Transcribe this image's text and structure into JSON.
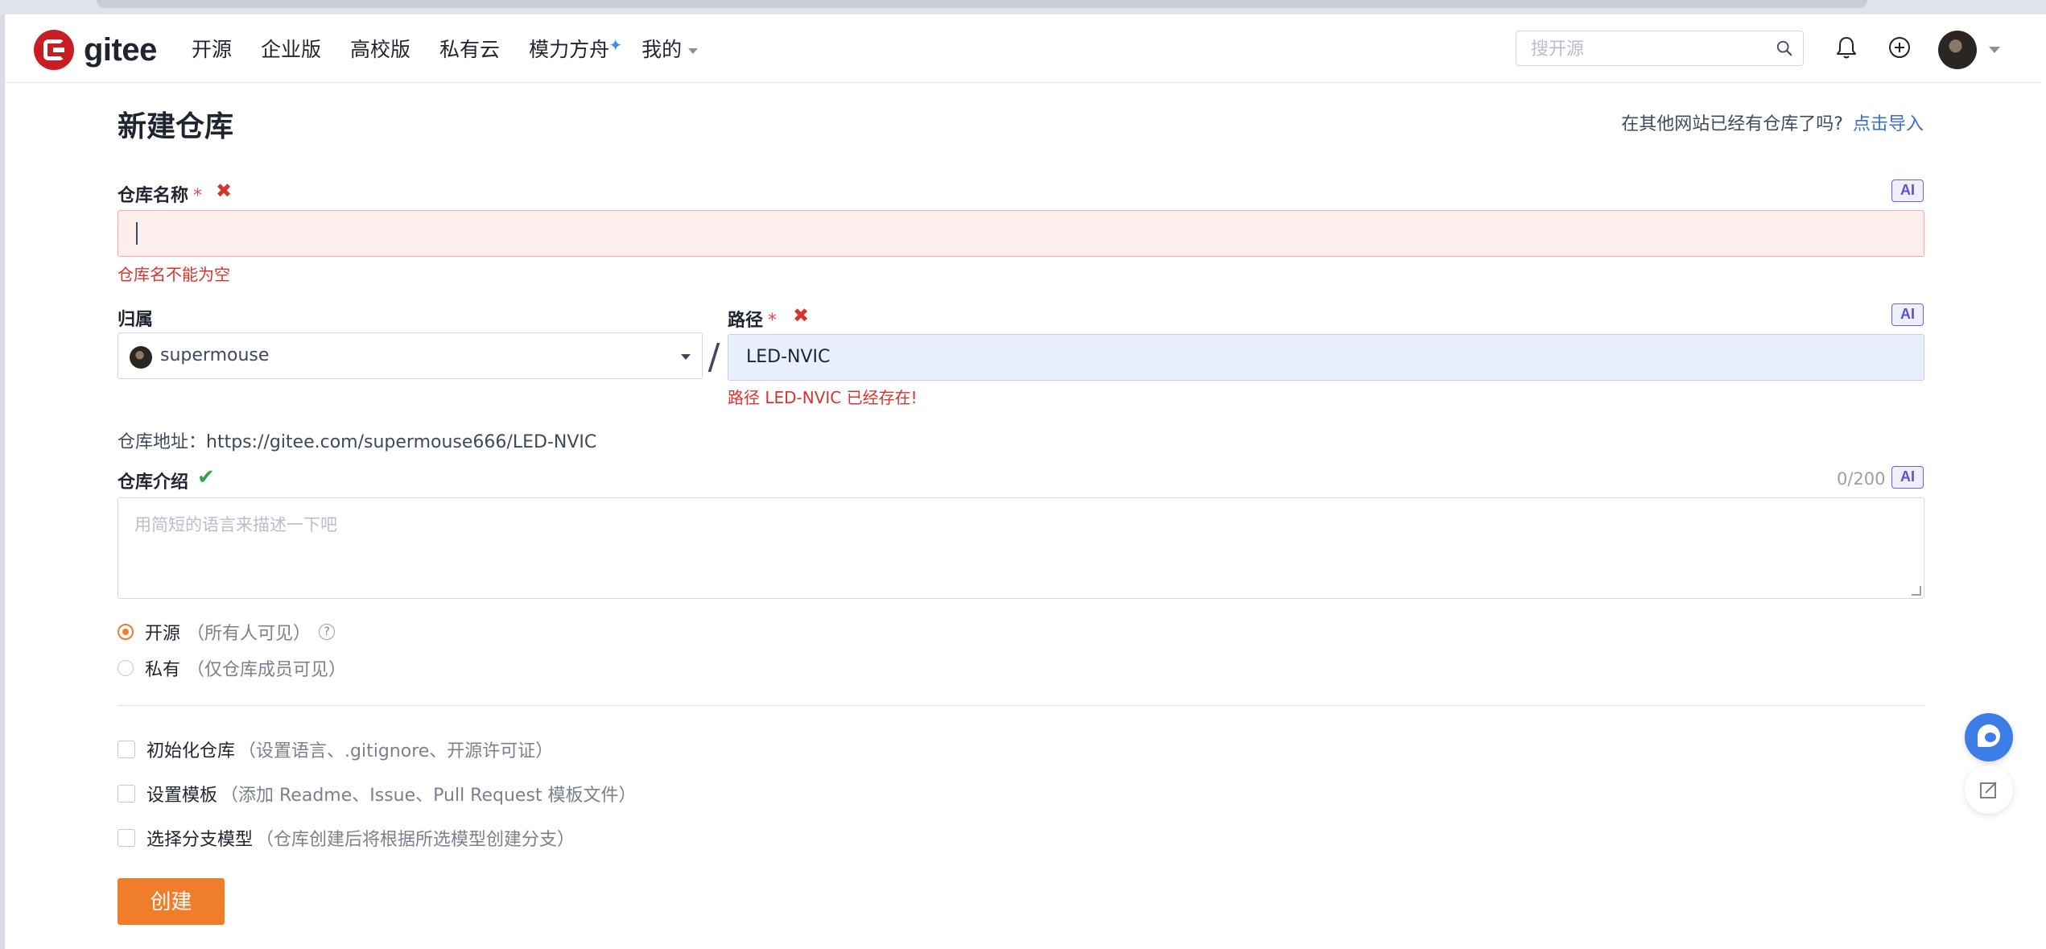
{
  "header": {
    "logo_text": "gitee",
    "nav": [
      "开源",
      "企业版",
      "高校版",
      "私有云",
      "模力方舟",
      "我的"
    ],
    "search_placeholder": "搜开源"
  },
  "page": {
    "title": "新建仓库",
    "import_question": "在其他网站已经有仓库了吗?",
    "import_link": "点击导入"
  },
  "form": {
    "name": {
      "label": "仓库名称",
      "required_mark": "*",
      "value": "",
      "error": "仓库名不能为空",
      "ai_label": "AI"
    },
    "owner": {
      "label": "归属",
      "value": "supermouse"
    },
    "separator": "/",
    "path": {
      "label": "路径",
      "required_mark": "*",
      "value": "LED-NVIC",
      "error": "路径 LED-NVIC 已经存在!",
      "ai_label": "AI"
    },
    "repo_url": "仓库地址：https://gitee.com/supermouse666/LED-NVIC",
    "description": {
      "label": "仓库介绍",
      "counter": "0/200",
      "placeholder": "用简短的语言来描述一下吧",
      "ai_label": "AI"
    },
    "visibility": {
      "selected": "open",
      "options": [
        {
          "label": "开源",
          "hint": "（所有人可见）",
          "help": "?"
        },
        {
          "label": "私有",
          "hint": "（仅仓库成员可见）"
        }
      ]
    },
    "extras": [
      {
        "label": "初始化仓库",
        "hint": "（设置语言、.gitignore、开源许可证）",
        "checked": false
      },
      {
        "label": "设置模板",
        "hint": "（添加 Readme、Issue、Pull Request 模板文件）",
        "checked": false
      },
      {
        "label": "选择分支模型",
        "hint": "（仓库创建后将根据所选模型创建分支）",
        "checked": false
      }
    ],
    "submit_label": "创建"
  },
  "colors": {
    "accent": "#f07d2a",
    "error": "#d7342f",
    "link": "#3b6ec9",
    "success": "#2ea44f"
  }
}
